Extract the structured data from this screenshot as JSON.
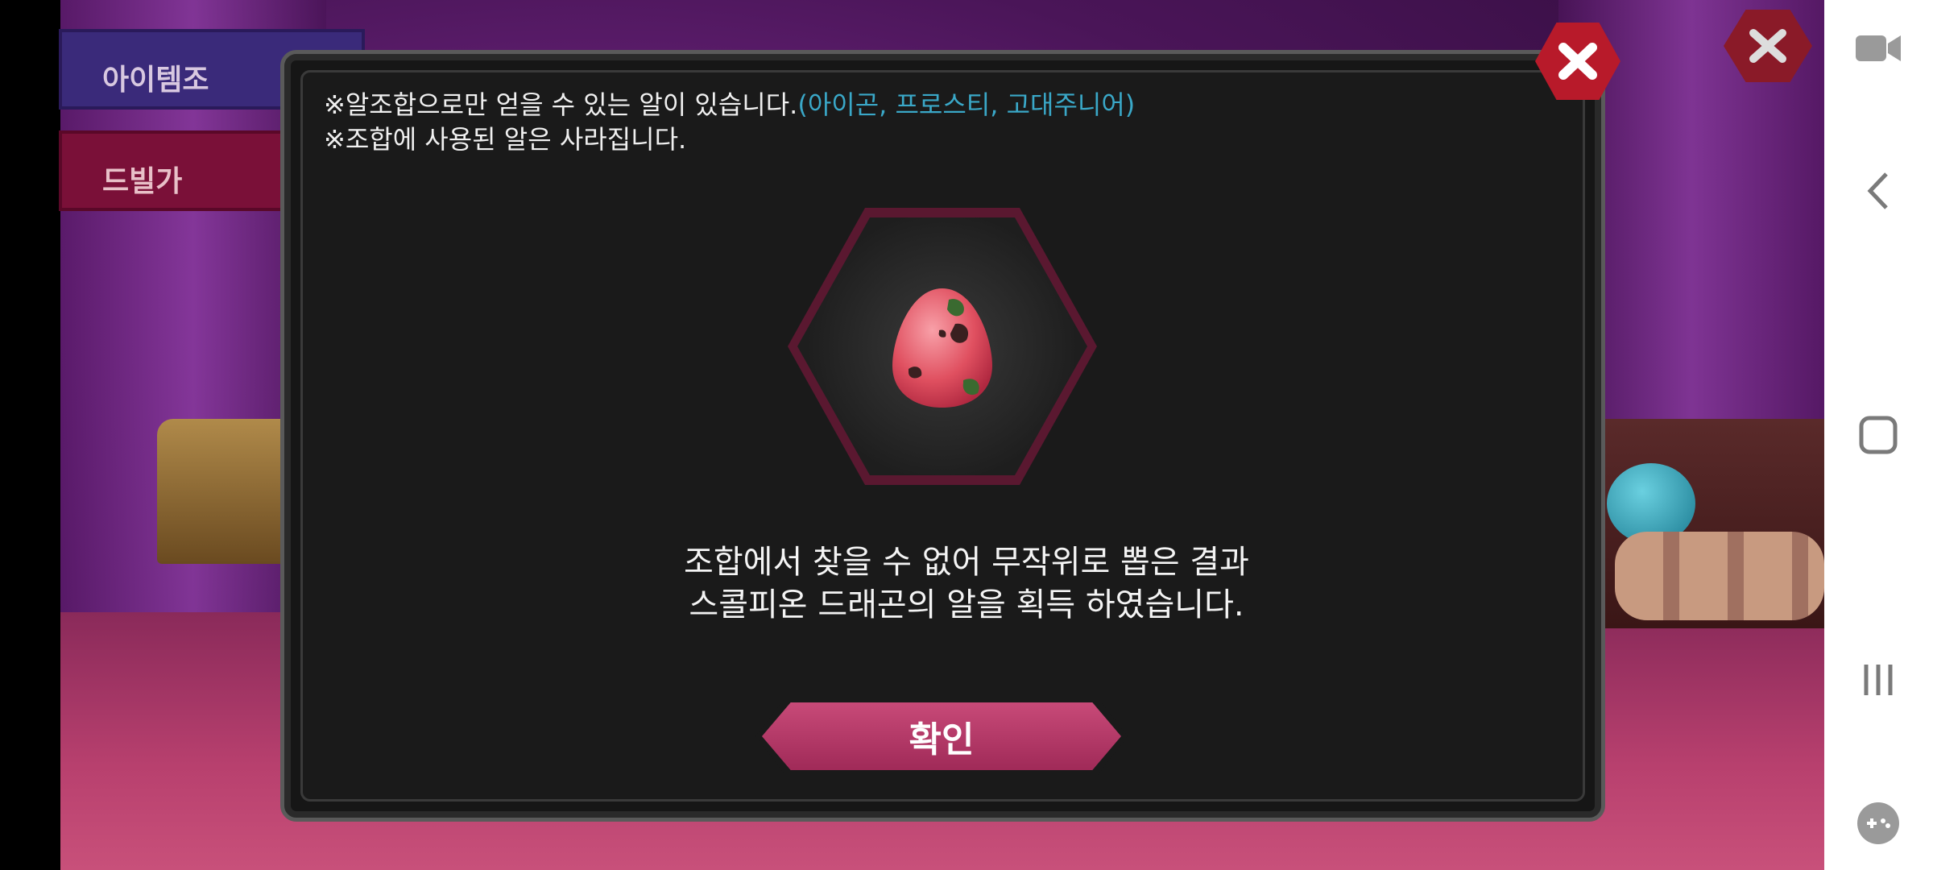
{
  "side_menu": {
    "item_1_label": "아이템조",
    "item_2_label": "드빌가"
  },
  "dialog": {
    "notice_line1_main": "※알조합으로만 얻을 수 있는 알이 있습니다.",
    "notice_line1_highlight": "(아이곤, 프로스티, 고대주니어)",
    "notice_line2": "※조합에 사용된 알은 사라집니다.",
    "result_line1": "조합에서 찾을 수 없어 무작위로 뽑은 결과",
    "result_line2": "스콜피온 드래곤의 알을 획득 하였습니다.",
    "confirm_label": "확인",
    "highlight_color": "#3aa8c8",
    "egg_icon": "scorpion-dragon-egg-icon"
  },
  "system_nav": {
    "icons": [
      "video-camera-icon",
      "back-icon",
      "home-icon",
      "recents-icon",
      "game-controller-icon"
    ]
  }
}
